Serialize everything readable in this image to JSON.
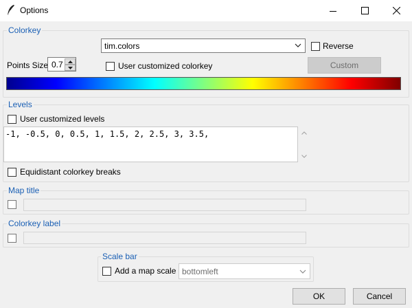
{
  "window": {
    "title": "Options",
    "icon": "feather-icon"
  },
  "colorkey": {
    "legend": "Colorkey",
    "colormap_value": "tim.colors",
    "reverse_label": "Reverse",
    "reverse_checked": false,
    "points_size_label": "Points Size",
    "points_size_value": "0.7",
    "user_colorkey_label": "User customized colorkey",
    "user_colorkey_checked": false,
    "custom_button_label": "Custom"
  },
  "levels": {
    "legend": "Levels",
    "user_levels_label": "User customized levels",
    "user_levels_checked": false,
    "values_text": "-1, -0.5, 0, 0.5, 1, 1.5, 2, 2.5, 3, 3.5,",
    "equidistant_label": "Equidistant colorkey breaks",
    "equidistant_checked": false
  },
  "map_title": {
    "legend": "Map title",
    "enabled": false,
    "value": ""
  },
  "colorkey_label": {
    "legend": "Colorkey label",
    "enabled": false,
    "value": ""
  },
  "scale_bar": {
    "legend": "Scale bar",
    "add_label": "Add a map scale",
    "add_checked": false,
    "position_value": "bottomleft"
  },
  "buttons": {
    "ok_label": "OK",
    "cancel_label": "Cancel"
  },
  "colors": {
    "legend_text": "#1a5fb4",
    "colorbar": [
      "#00008f",
      "#0000ff",
      "#0080ff",
      "#00ffff",
      "#80ff80",
      "#ffff00",
      "#ff8000",
      "#ff0000",
      "#800000"
    ]
  }
}
